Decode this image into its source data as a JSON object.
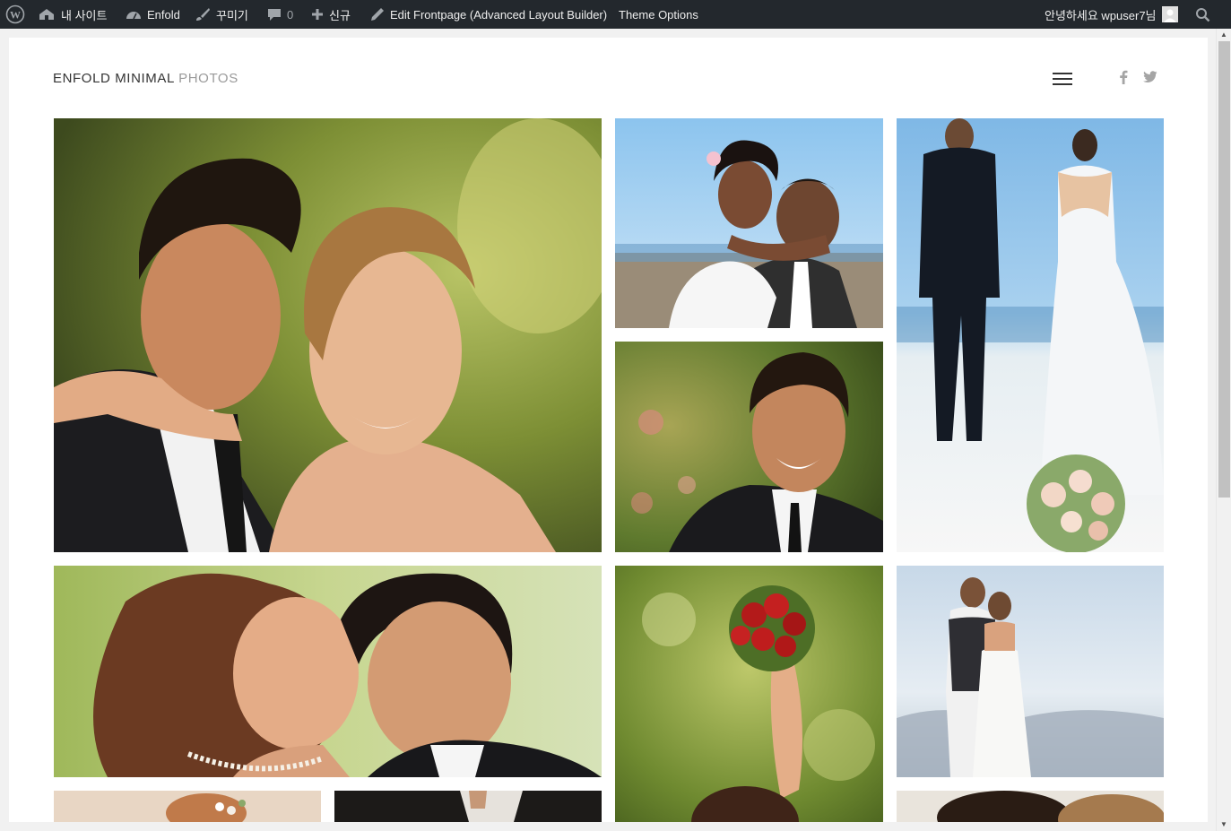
{
  "adminbar": {
    "my_site": "내 사이트",
    "site_name": "Enfold",
    "customize": "꾸미기",
    "comments_count": "0",
    "new": "신규",
    "edit_frontpage": "Edit Frontpage (Advanced Layout Builder)",
    "theme_options": "Theme Options",
    "greeting": "안녕하세요 wpuser7님",
    "icons": [
      "wordpress-icon",
      "home-icon",
      "dashboard-icon",
      "brush-icon",
      "comment-icon",
      "plus-icon",
      "pencil-icon",
      "avatar",
      "search-icon"
    ]
  },
  "header": {
    "logo_main": "ENFOLD MINIMAL",
    "logo_light": "PHOTOS"
  },
  "social": [
    "facebook-icon",
    "twitter-icon"
  ],
  "gallery": [
    "couple-embrace-photo",
    "bride-hugging-groom-beach-photo",
    "couple-walking-beach-photo",
    "smiling-groom-photo",
    "couple-face-to-face-photo",
    "bride-bouquet-raised-photo",
    "couple-cliff-photo",
    "bride-flowers-hair-photo",
    "groom-suit-dark-photo",
    "couple-closeup-photo"
  ],
  "colors": {
    "adminbar_bg": "#23282d",
    "page_bg": "#ffffff",
    "frame_bg": "#f1f1f1"
  }
}
